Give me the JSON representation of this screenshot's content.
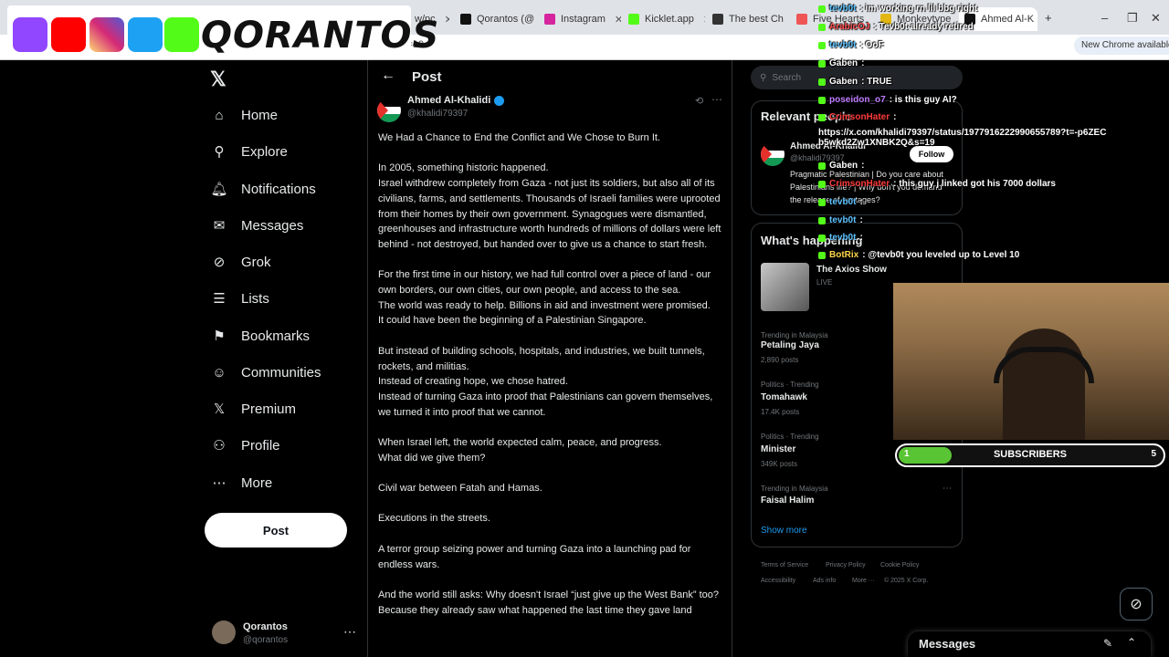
{
  "browser": {
    "tabs": [
      {
        "label": "w/pc",
        "color": "#777"
      },
      {
        "label": "Qorantos (@",
        "color": "#111"
      },
      {
        "label": "Instagram",
        "color": "#d6249f"
      },
      {
        "label": "Kicklet.app",
        "color": "#53fc18"
      },
      {
        "label": "The best Ch",
        "color": "#333"
      },
      {
        "label": "Five Hearts",
        "color": "#e55"
      },
      {
        "label": "Monkeytype",
        "color": "#e2b714"
      },
      {
        "label": "Ahmed Al-K",
        "color": "#111"
      }
    ],
    "url": "s=19",
    "new_chrome": "New Chrome available"
  },
  "banner": {
    "brand": "QORANTOS",
    "icons": [
      "twitch-icon",
      "youtube-icon",
      "instagram-icon",
      "twitter-icon",
      "kick-icon"
    ]
  },
  "nav": {
    "items": [
      {
        "label": "Home",
        "icon": "home-icon"
      },
      {
        "label": "Explore",
        "icon": "search-icon"
      },
      {
        "label": "Notifications",
        "icon": "bell-icon"
      },
      {
        "label": "Messages",
        "icon": "mail-icon"
      },
      {
        "label": "Grok",
        "icon": "grok-icon"
      },
      {
        "label": "Lists",
        "icon": "list-icon"
      },
      {
        "label": "Bookmarks",
        "icon": "bookmark-icon"
      },
      {
        "label": "Communities",
        "icon": "people-icon"
      },
      {
        "label": "Premium",
        "icon": "x-icon"
      },
      {
        "label": "Profile",
        "icon": "user-icon"
      },
      {
        "label": "More",
        "icon": "more-icon"
      }
    ],
    "post_button": "Post",
    "account": {
      "name": "Qorantos",
      "handle": "@qorantos"
    }
  },
  "post": {
    "header": "Post",
    "author": "Ahmed Al-Khalidi",
    "handle": "@khalidi79397",
    "paragraphs": [
      "We Had a Chance to End the Conflict and We Chose to Burn It.",
      "In 2005, something historic happened.\nIsrael withdrew completely from Gaza - not just its soldiers, but also all of its civilians, farms, and settlements. Thousands of Israeli families were uprooted from their homes by their own government. Synagogues were dismantled, greenhouses and infrastructure worth hundreds of millions of dollars were left behind - not destroyed, but handed over to give us a chance to start fresh.",
      "For the first time in our history, we had full control over a piece of land - our own borders, our own cities, our own people, and access to the sea.\nThe world was ready to help. Billions in aid and investment were promised.\nIt could have been the beginning of a Palestinian Singapore.",
      "But instead of building schools, hospitals, and industries, we built tunnels, rockets, and militias.\nInstead of creating hope, we chose hatred.\nInstead of turning Gaza into proof that Palestinians can govern themselves, we turned it into proof that we cannot.",
      "When Israel left, the world expected calm, peace, and progress.\nWhat did we give them?",
      "Civil war between Fatah and Hamas.",
      "Executions in the streets.",
      "A terror group seizing power and turning Gaza into a launching pad for endless wars.",
      "And the world still asks: Why doesn't Israel “just give up the West Bank” too?\nBecause they already saw what happened the last time they gave land"
    ]
  },
  "sidebar": {
    "search_placeholder": "Search",
    "relevant_title": "Relevant people",
    "relevant": {
      "name": "Ahmed Al-Khalidi",
      "handle": "@khalidi79397",
      "bio": "Pragmatic Palestinian | Do you care about Palestinians life? | Why don't you demand the release of hostages?",
      "follow": "Follow"
    },
    "happening_title": "What's happening",
    "axios": {
      "title": "The Axios Show",
      "status": "LIVE"
    },
    "trends": [
      {
        "meta": "Trending in Malaysia",
        "name": "Petaling Jaya",
        "count": "2,890 posts"
      },
      {
        "meta": "Politics · Trending",
        "name": "Tomahawk",
        "count": "17.4K posts"
      },
      {
        "meta": "Politics · Trending",
        "name": "Minister",
        "count": "349K posts"
      },
      {
        "meta": "Trending in Malaysia",
        "name": "Faisal Halim",
        "count": ""
      }
    ],
    "show_more": "Show more",
    "footer": [
      "Terms of Service",
      "Privacy Policy",
      "Cookie Policy",
      "Accessibility",
      "Ads info",
      "More ···",
      "© 2025 X Corp."
    ]
  },
  "chat": [
    {
      "user": "tevb0t",
      "text": ": im working rn lil bbg right",
      "color": "#5ec2ff"
    },
    {
      "user": "ArabicOJ",
      "text": ": Tevb0t already retired",
      "color": "#ff4d4d"
    },
    {
      "user": "tevb0t",
      "text": ": OoF",
      "color": "#5ec2ff"
    },
    {
      "user": "Gaben",
      "text": ":",
      "color": "#fff"
    },
    {
      "user": "Gaben",
      "text": ": TRUE",
      "color": "#fff"
    },
    {
      "user": "poseidon_o7",
      "text": ": is this guy AI?",
      "color": "#c07cff"
    },
    {
      "user": "CrimsonHater",
      "text": ":",
      "color": "#ff3b3b"
    },
    {
      "user": "",
      "text": "https://x.com/khalidi79397/status/1977916222990655789?t=-p6ZECb5wkd2Zw1XNBK2Q&s=19",
      "color": "#fff"
    },
    {
      "user": "Gaben",
      "text": ":",
      "color": "#fff"
    },
    {
      "user": "CrimsonHater",
      "text": ": this guy j linked got his 7000 dollars",
      "color": "#ff3b3b"
    },
    {
      "user": "tevb0t",
      "text": ":",
      "color": "#5ec2ff"
    },
    {
      "user": "tevb0t",
      "text": ":",
      "color": "#5ec2ff"
    },
    {
      "user": "tevb0t",
      "text": ":",
      "color": "#5ec2ff"
    },
    {
      "user": "BotRix",
      "text": ": @tevb0t you leveled up to Level 10",
      "color": "#ffd54a"
    }
  ],
  "subs": {
    "label": "SUBSCRIBERS",
    "current": "1",
    "goal": "5",
    "progress": 0.2
  },
  "messages_drawer": {
    "title": "Messages"
  }
}
